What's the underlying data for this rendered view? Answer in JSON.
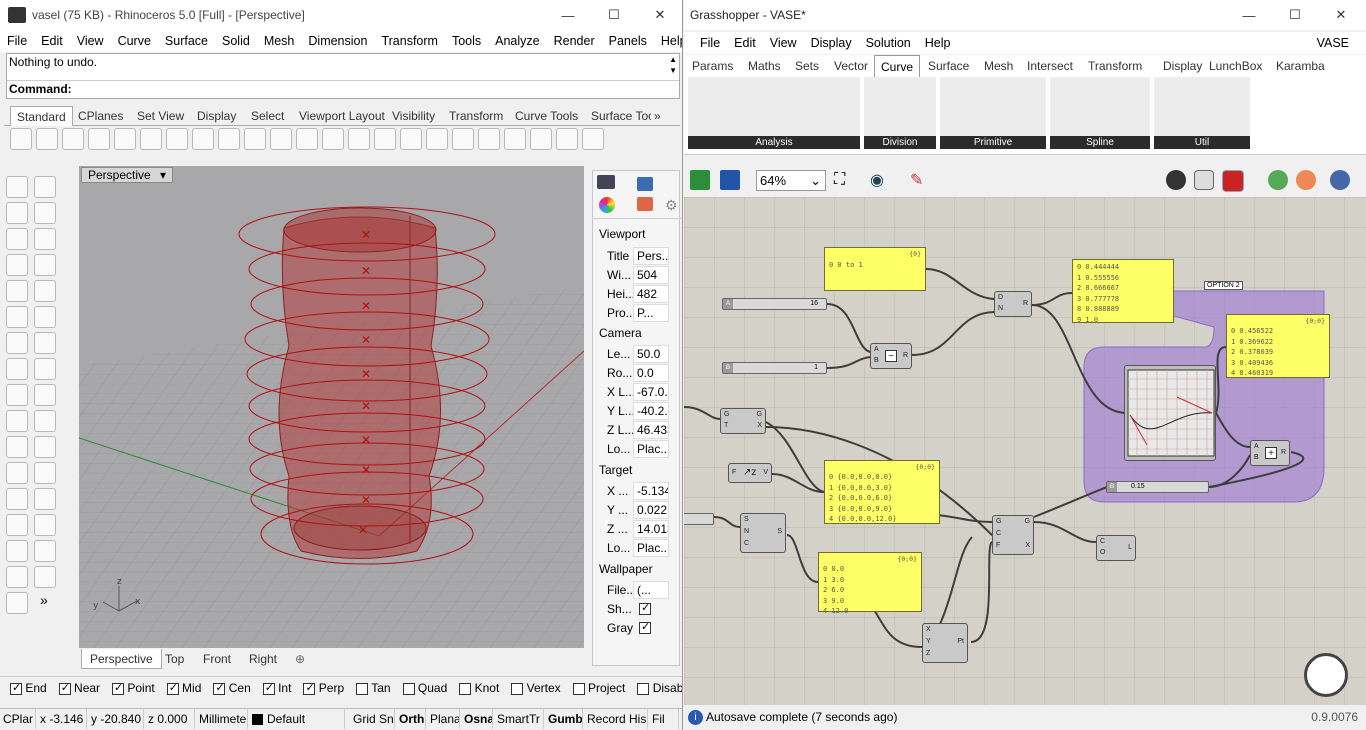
{
  "rhino": {
    "title": "vasel (75 KB) - Rhinoceros 5.0 [Full] - [Perspective]",
    "menu": [
      "File",
      "Edit",
      "View",
      "Curve",
      "Surface",
      "Solid",
      "Mesh",
      "Dimension",
      "Transform",
      "Tools",
      "Analyze",
      "Render",
      "Panels",
      "Help"
    ],
    "history": "Nothing to undo.",
    "command_label": "Command:",
    "toolbar_tabs": [
      "Standard",
      "CPlanes",
      "Set View",
      "Display",
      "Select",
      "Viewport Layout",
      "Visibility",
      "Transform",
      "Curve Tools",
      "Surface Too"
    ],
    "viewport_title": "Perspective",
    "viewport_tabs": [
      "Perspective",
      "Top",
      "Front",
      "Right"
    ],
    "props": {
      "viewport_section": "Viewport",
      "camera_section": "Camera",
      "target_section": "Target",
      "wallpaper_section": "Wallpaper",
      "rows_viewport": [
        {
          "k": "Title",
          "v": "Pers..."
        },
        {
          "k": "Wi...",
          "v": "504"
        },
        {
          "k": "Hei...",
          "v": "482"
        },
        {
          "k": "Pro...",
          "v": "P..."
        }
      ],
      "rows_camera": [
        {
          "k": "Le...",
          "v": "50.0"
        },
        {
          "k": "Ro...",
          "v": "0.0"
        },
        {
          "k": "X L...",
          "v": "-67.0..."
        },
        {
          "k": "Y L...",
          "v": "-40.2..."
        },
        {
          "k": "Z L...",
          "v": "46.433"
        },
        {
          "k": "Lo...",
          "v": "Plac..."
        }
      ],
      "rows_target": [
        {
          "k": "X ...",
          "v": "-5.134"
        },
        {
          "k": "Y ...",
          "v": "0.022"
        },
        {
          "k": "Z ...",
          "v": "14.013"
        },
        {
          "k": "Lo...",
          "v": "Plac..."
        }
      ],
      "rows_wallpaper": [
        {
          "k": "File...",
          "v": "(..."
        },
        {
          "k": "Sh...",
          "v": ""
        },
        {
          "k": "Gray",
          "v": ""
        }
      ]
    },
    "osnaps": [
      {
        "label": "End",
        "on": true
      },
      {
        "label": "Near",
        "on": true
      },
      {
        "label": "Point",
        "on": true
      },
      {
        "label": "Mid",
        "on": true
      },
      {
        "label": "Cen",
        "on": true
      },
      {
        "label": "Int",
        "on": true
      },
      {
        "label": "Perp",
        "on": true
      },
      {
        "label": "Tan",
        "on": false
      },
      {
        "label": "Quad",
        "on": false
      },
      {
        "label": "Knot",
        "on": false
      },
      {
        "label": "Vertex",
        "on": false
      },
      {
        "label": "Project",
        "on": false
      },
      {
        "label": "Disable",
        "on": false
      }
    ],
    "status": [
      "CPlar",
      "x -3.146",
      "y -20.840",
      "z 0.000",
      "Millimete",
      "Default",
      "Grid Sn",
      "Orth",
      "Plana",
      "Osna",
      "SmartTr",
      "Gumb",
      "Record His",
      "Fil"
    ]
  },
  "gh": {
    "title": "Grasshopper - VASE*",
    "doc_name": "VASE",
    "menu": [
      "File",
      "Edit",
      "View",
      "Display",
      "Solution",
      "Help"
    ],
    "tabs": [
      "Params",
      "Maths",
      "Sets",
      "Vector",
      "Curve",
      "Surface",
      "Mesh",
      "Intersect",
      "Transform",
      "Display",
      "LunchBox",
      "Karamba"
    ],
    "active_tab": "Curve",
    "categories": [
      "Analysis",
      "Division",
      "Primitive",
      "Spline",
      "Util"
    ],
    "zoom": "64%",
    "status": "Autosave complete (7 seconds ago)",
    "version": "0.9.0076",
    "group_label": "OPTION 2",
    "panels": {
      "p1": {
        "head": "{0}",
        "lines": [
          "0 0 to 1"
        ]
      },
      "p2": {
        "head": "",
        "lines": [
          "0 0.444444",
          "1 0.555556",
          "2 0.666667",
          "3 0.777778",
          "8 0.888889",
          "9 1.0"
        ]
      },
      "p3": {
        "head": "{0;0}",
        "lines": [
          "0 0.456522",
          "1 0.369622",
          "2 0.378039",
          "3 0.409436",
          "4 0.460319"
        ]
      },
      "p4": {
        "head": "{0;0}",
        "lines": [
          "0 {0.0,0.0,0.0}",
          "1 {0.0,0.0,3.0}",
          "2 {0.0,0.0,6.0}",
          "3 {0.0,0.0,9.0}",
          "4 {0.0,0.0,12.0}"
        ]
      },
      "p5": {
        "head": "{0;0}",
        "lines": [
          "0 0.0",
          "1 3.0",
          "2 6.0",
          "3 9.0",
          "4 12.0"
        ]
      }
    },
    "sliders": {
      "a": "16",
      "b": "1",
      "c": "0.15"
    }
  }
}
